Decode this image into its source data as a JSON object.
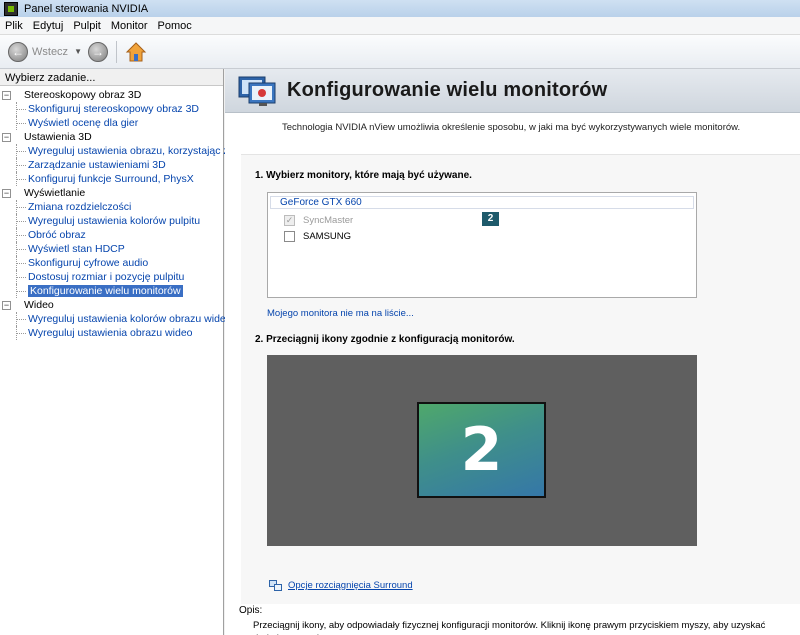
{
  "window": {
    "title": "Panel sterowania NVIDIA"
  },
  "menu": [
    "Plik",
    "Edytuj",
    "Pulpit",
    "Monitor",
    "Pomoc"
  ],
  "toolbar": {
    "back_label": "Wstecz"
  },
  "sidebar": {
    "header": "Wybierz zadanie...",
    "groups": [
      {
        "label": "Stereoskopowy obraz 3D",
        "items": [
          "Skonfiguruj stereoskopowy obraz 3D",
          "Wyświetl ocenę dla gier"
        ]
      },
      {
        "label": "Ustawienia 3D",
        "items": [
          "Wyreguluj ustawienia obrazu, korzystając z",
          "Zarządzanie ustawieniami 3D",
          "Konfiguruj funkcje Surround, PhysX"
        ]
      },
      {
        "label": "Wyświetlanie",
        "items": [
          "Zmiana rozdzielczości",
          "Wyreguluj ustawienia kolorów pulpitu",
          "Obróć obraz",
          "Wyświetl stan HDCP",
          "Skonfiguruj cyfrowe audio",
          "Dostosuj rozmiar i pozycję pulpitu",
          "Konfigurowanie wielu monitorów"
        ]
      },
      {
        "label": "Wideo",
        "items": [
          "Wyreguluj ustawienia kolorów obrazu wideo",
          "Wyreguluj ustawienia obrazu wideo"
        ]
      }
    ],
    "selected": "Konfigurowanie wielu monitorów"
  },
  "page": {
    "title": "Konfigurowanie wielu monitorów",
    "intro": "Technologia NVIDIA nView umożliwia określenie sposobu, w jaki ma być wykorzystywanych wiele monitorów.",
    "section1_title": "1. Wybierz monitory, które mają być używane.",
    "gpu_name": "GeForce GTX 660",
    "monitors": [
      {
        "name": "SyncMaster",
        "checked": true,
        "disabled": true,
        "badge": "2"
      },
      {
        "name": "SAMSUNG",
        "checked": false,
        "disabled": false
      }
    ],
    "missing_link": "Mojego monitora nie ma na liście...",
    "section2_title": "2. Przeciągnij ikony zgodnie z konfiguracją monitorów.",
    "monitor_tile_number": "2",
    "surround_link": "Opcje rozciągnięcia Surround",
    "description_label": "Opis:",
    "description_text": "Przeciągnij ikony, aby odpowiadały fizycznej konfiguracji monitorów. Kliknij ikonę prawym przyciskiem myszy, aby uzyskać dodatkowe opcje."
  },
  "colors": {
    "accent": "#76b900",
    "selection": "#3a6fc4",
    "link": "#0645ad",
    "tile_badge": "#1e5a6b"
  }
}
